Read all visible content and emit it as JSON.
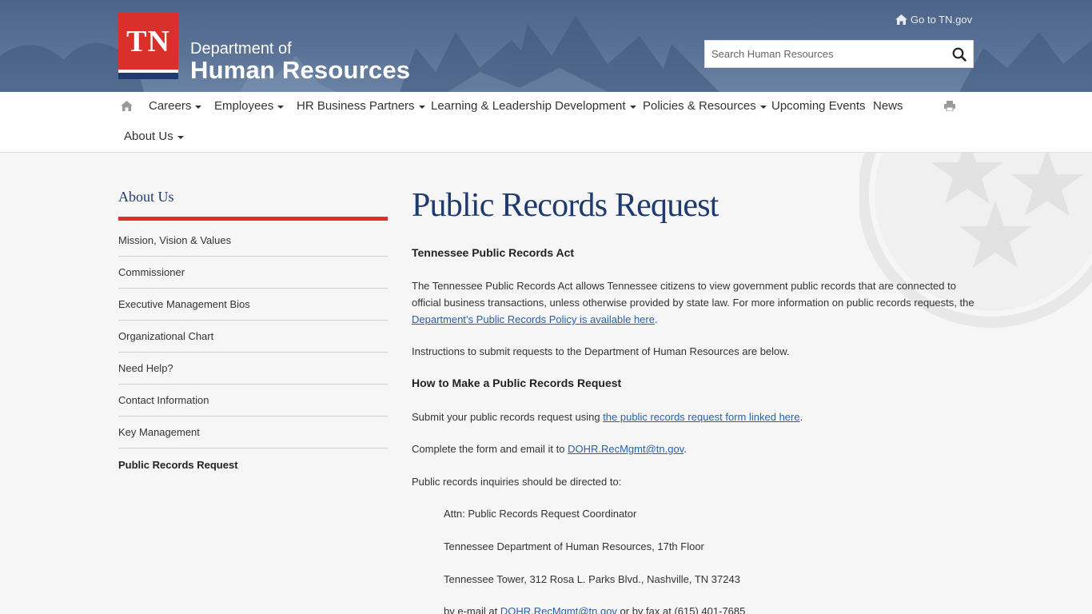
{
  "header": {
    "logo_text": "TN",
    "dept_line1": "Department of",
    "dept_line2": "Human Resources",
    "go_to_label": "Go to TN.gov",
    "search_placeholder": "Search Human Resources"
  },
  "nav": {
    "items": [
      {
        "label": "Careers"
      },
      {
        "label": "Employees"
      },
      {
        "label": "HR Business Partners"
      },
      {
        "label": "Learning & Leadership Development"
      },
      {
        "label": "Policies & Resources"
      },
      {
        "label": "Upcoming Events"
      },
      {
        "label": "News"
      },
      {
        "label": "About Us"
      }
    ]
  },
  "sidebar": {
    "title": "About Us",
    "items": [
      {
        "label": "Mission, Vision & Values"
      },
      {
        "label": "Commissioner"
      },
      {
        "label": "Executive Management Bios"
      },
      {
        "label": "Organizational Chart"
      },
      {
        "label": "Need Help?"
      },
      {
        "label": "Contact Information"
      },
      {
        "label": "Key Management"
      },
      {
        "label": "Public Records Request"
      }
    ]
  },
  "main": {
    "title": "Public Records Request",
    "h_act": "Tennessee Public Records Act",
    "p_act_1": "The Tennessee Public Records Act allows Tennessee citizens to view government public records that are connected to",
    "p_act_2": "official business transactions, unless otherwise provided by state law. For more information on public records requests, the",
    "p_act_link": "Department’s Public Records Policy is available here",
    "p_instructions": "Instructions to submit requests to the Department of Human Resources are below.",
    "h_how": "How to Make a Public Records Request",
    "p_submit_prefix": "Submit your public records request using ",
    "p_submit_link": "the public records request form linked here",
    "p_email_prefix": "Complete the form and email it to ",
    "email": "DOHR.RecMgmt@tn.gov",
    "p_inquiries": "Public records inquiries should be directed to:",
    "addr_attn": "Attn: Public Records Request Coordinator",
    "addr_dept": "Tennessee Department of Human Resources, 17th Floor",
    "addr_tower": "Tennessee Tower, 312 Rosa L. Parks Blvd., Nashville, TN 37243",
    "addr_contact_prefix": "by e-mail at ",
    "addr_contact_suffix": " or by fax at (615) 401-7685"
  }
}
